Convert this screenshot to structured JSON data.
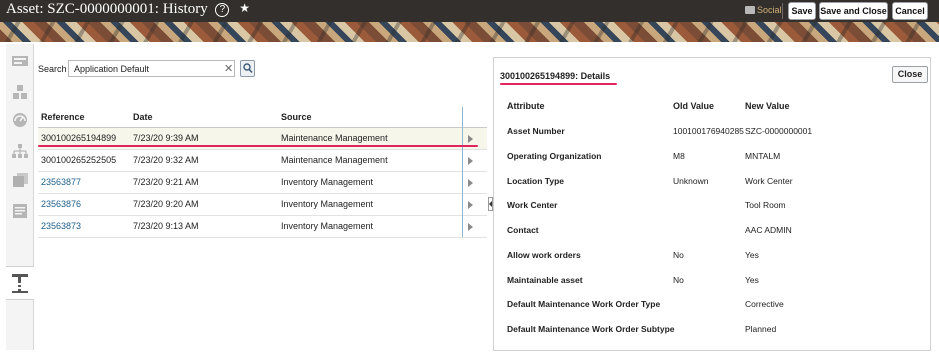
{
  "header": {
    "title": "Asset: SZC-0000000001:",
    "subtitle": "History",
    "help_glyph": "?",
    "star_glyph": "★",
    "social_label": "Social",
    "buttons": {
      "save": "Save",
      "save_close": "Save and Close",
      "cancel": "Cancel"
    }
  },
  "sidebar": {
    "icons": [
      "news-icon",
      "assets-grid-icon",
      "dashboard-gauge-icon",
      "hierarchy-icon",
      "documents-icon",
      "notes-icon",
      "history-icon"
    ]
  },
  "search": {
    "label": "Search",
    "value": "Application Default",
    "clear_glyph": "✕"
  },
  "table": {
    "headers": {
      "reference": "Reference",
      "date": "Date",
      "source": "Source"
    },
    "rows": [
      {
        "reference": "300100265194899",
        "date": "7/23/20 9:39 AM",
        "source": "Maintenance Management",
        "link": false,
        "selected": true
      },
      {
        "reference": "300100265252505",
        "date": "7/23/20 9:32 AM",
        "source": "Maintenance Management",
        "link": false,
        "selected": false
      },
      {
        "reference": "23563877",
        "date": "7/23/20 9:21 AM",
        "source": "Inventory Management",
        "link": true,
        "selected": false
      },
      {
        "reference": "23563876",
        "date": "7/23/20 9:20 AM",
        "source": "Inventory Management",
        "link": true,
        "selected": false
      },
      {
        "reference": "23563873",
        "date": "7/23/20 9:13 AM",
        "source": "Inventory Management",
        "link": true,
        "selected": false
      }
    ]
  },
  "details": {
    "title": "300100265194899: Details",
    "close_label": "Close",
    "headers": {
      "attribute": "Attribute",
      "old": "Old Value",
      "new": "New Value"
    },
    "rows": [
      {
        "attribute": "Asset Number",
        "old": "100100176940285",
        "new": "SZC-0000000001"
      },
      {
        "attribute": "Operating Organization",
        "old": "M8",
        "new": "MNTALM"
      },
      {
        "attribute": "Location Type",
        "old": "Unknown",
        "new": "Work Center"
      },
      {
        "attribute": "Work Center",
        "old": "",
        "new": "Tool Room"
      },
      {
        "attribute": "Contact",
        "old": "",
        "new": "AAC ADMIN"
      },
      {
        "attribute": "Allow work orders",
        "old": "No",
        "new": "Yes"
      },
      {
        "attribute": "Maintainable asset",
        "old": "No",
        "new": "Yes"
      },
      {
        "attribute": "Default Maintenance Work Order Type",
        "old": "",
        "new": "Corrective"
      },
      {
        "attribute": "Default Maintenance Work Order Subtype",
        "old": "",
        "new": "Planned"
      }
    ]
  },
  "colors": {
    "header_bg": "#322f2c",
    "link": "#1d5f8a",
    "highlight": "#e0245e",
    "social": "#d2b176"
  }
}
